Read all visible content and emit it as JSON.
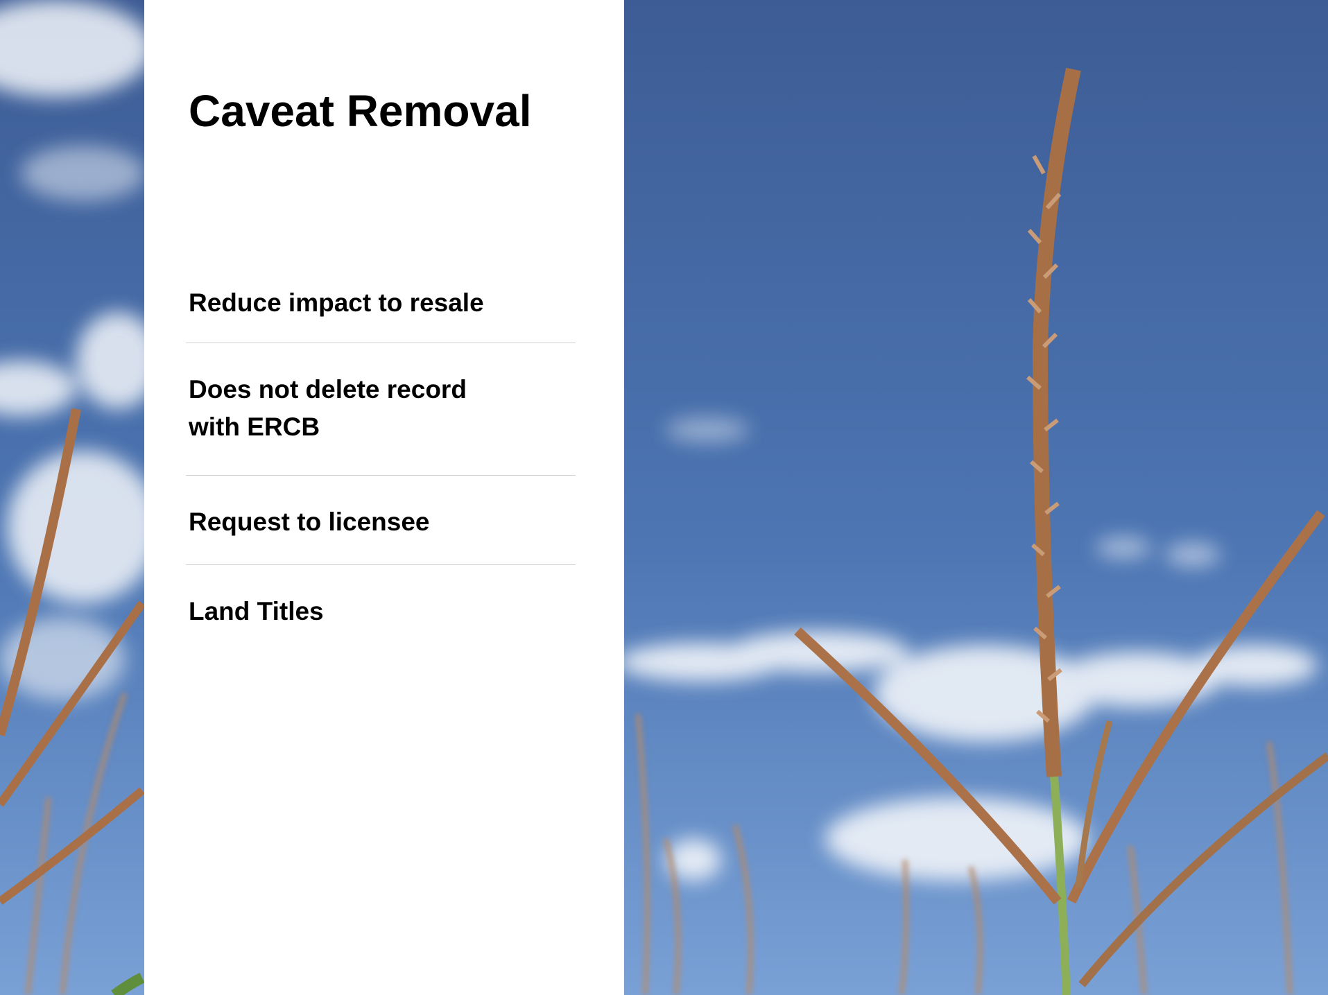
{
  "slide": {
    "title": "Caveat Removal",
    "bullets": [
      "Reduce impact to resale",
      "Does not delete record\nwith ERCB",
      "Request to licensee",
      "Land Titles"
    ]
  },
  "colors": {
    "sky_top": "#3f5f98",
    "sky_bottom": "#6f98d2",
    "cloud": "#eef2f7",
    "wheat": "#b07a4e",
    "stem": "#8fae58",
    "panel": "#ffffff",
    "text": "#000000",
    "divider": "#cfcfcf"
  }
}
